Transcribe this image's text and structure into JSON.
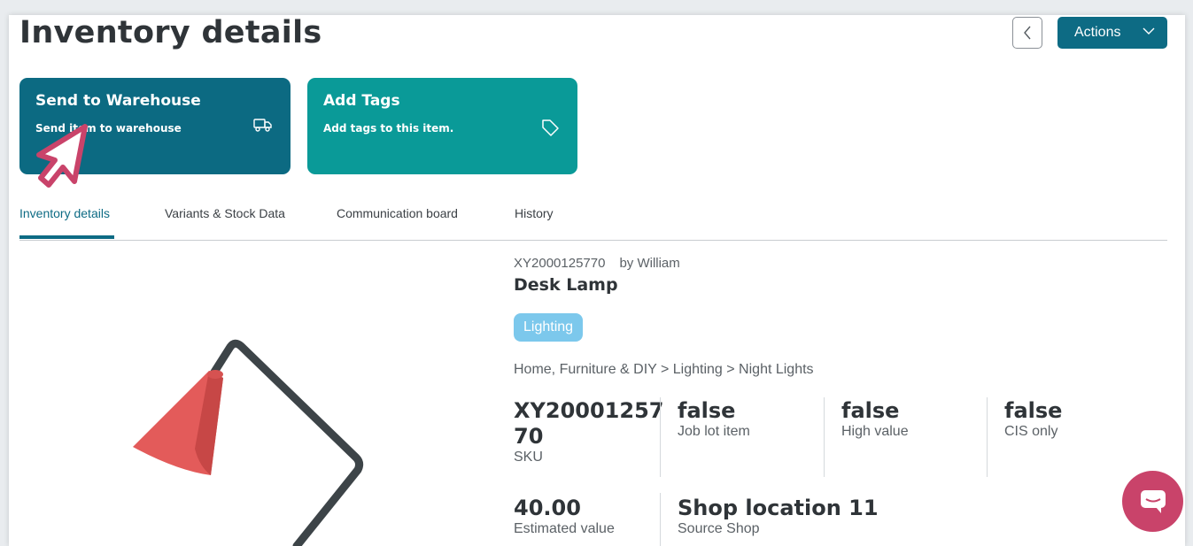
{
  "header": {
    "title": "Inventory details",
    "actions_label": "Actions"
  },
  "cards": [
    {
      "title": "Send to Warehouse",
      "description": "Send item to warehouse",
      "icon": "truck-icon"
    },
    {
      "title": "Add Tags",
      "description": "Add tags to this item.",
      "icon": "tag-icon"
    }
  ],
  "tabs": [
    {
      "label": "Inventory details",
      "active": true
    },
    {
      "label": "Variants & Stock Data",
      "active": false
    },
    {
      "label": "Communication board",
      "active": false
    },
    {
      "label": "History",
      "active": false
    }
  ],
  "item": {
    "id": "XY2000125770",
    "owner": "by William",
    "name": "Desk Lamp",
    "tag": "Lighting",
    "category_path": "Home, Furniture & DIY > Lighting > Night Lights",
    "stats": [
      {
        "value": "XY2000125770",
        "label": "SKU"
      },
      {
        "value": "false",
        "label": "Job lot item"
      },
      {
        "value": "false",
        "label": "High value"
      },
      {
        "value": "false",
        "label": "CIS only"
      },
      {
        "value": "40.00",
        "label": "Estimated value"
      },
      {
        "value": "Shop location 11",
        "label": "Source Shop"
      }
    ]
  },
  "colors": {
    "primary": "#0d6b84",
    "teal_card": "#0a9a98",
    "tag": "#7cc8ec",
    "chat": "#c9436a",
    "pointer": "#c9436a"
  }
}
